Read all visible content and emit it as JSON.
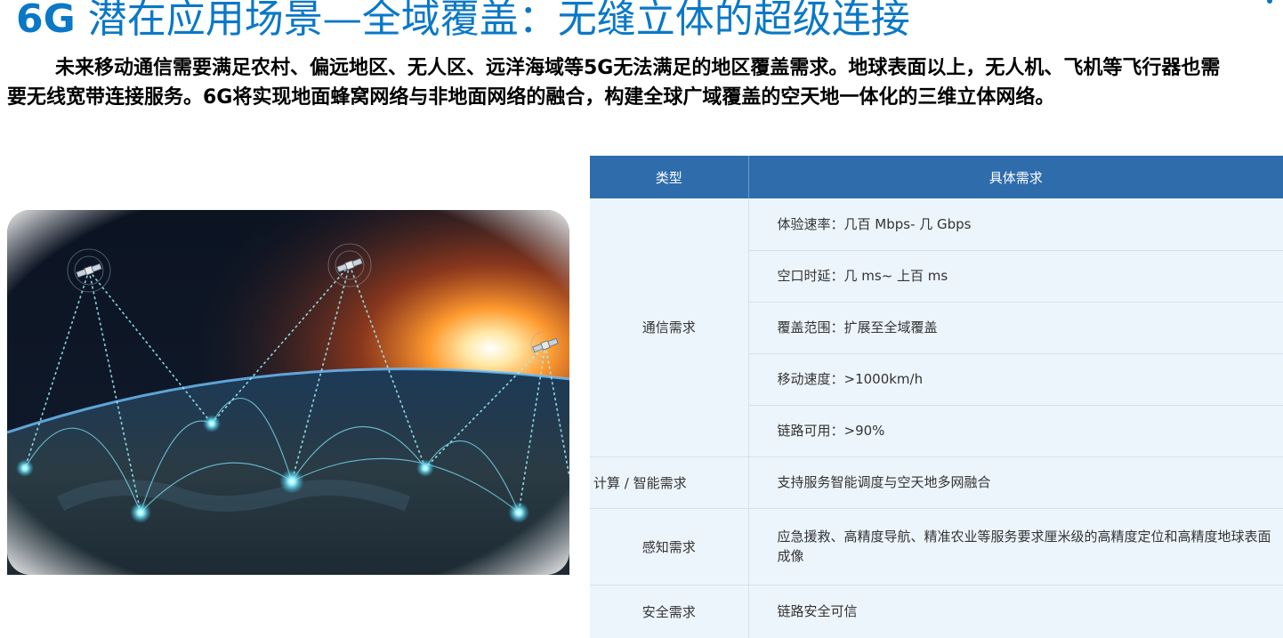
{
  "title": {
    "prefix": "6G",
    "rest": " 潜在应用场景—全域覆盖：无缝立体的超级连接"
  },
  "intro": "未来移动通信需要满足农村、偏远地区、无人区、远洋海域等5G无法满足的地区覆盖需求。地球表面以上，无人机、飞机等飞行器也需要无线宽带连接服务。6G将实现地面蜂窝网络与非地面网络的融合，构建全球广域覆盖的空天地一体化的三维立体网络。",
  "table": {
    "headers": [
      "类型",
      "具体需求"
    ],
    "groups": [
      {
        "type": "通信需求",
        "items": [
          "体验速率：几百 Mbps- 几 Gbps",
          "空口时延：几 ms~ 上百 ms",
          "覆盖范围：扩展至全域覆盖",
          "移动速度：>1000km/h",
          "链路可用：>90%"
        ]
      },
      {
        "type": "计算 / 智能需求",
        "items": [
          "支持服务智能调度与空天地多网融合"
        ]
      },
      {
        "type": "感知需求",
        "items": [
          "应急援救、高精度导航、精准农业等服务要求厘米级的高精度定位和高精度地球表面成像"
        ]
      },
      {
        "type": "安全需求",
        "items": [
          "链路安全可信"
        ]
      }
    ]
  },
  "colors": {
    "title": "#0a78c7",
    "table_header": "#2f6cac",
    "table_body": "#edf5fc"
  },
  "image": {
    "icon": "satellite-earth-network-picture"
  }
}
